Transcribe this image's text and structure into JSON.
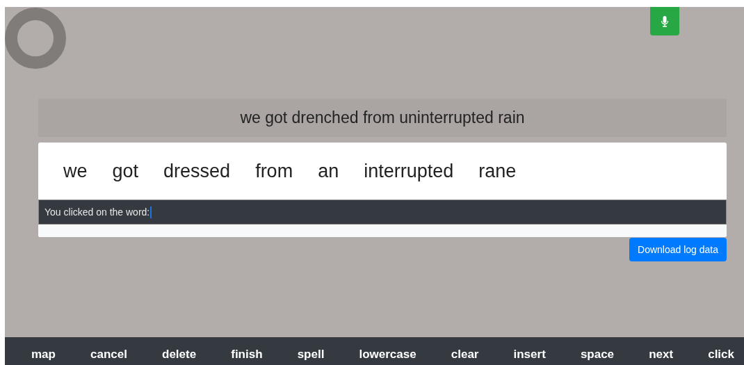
{
  "target_sentence": "we got drenched from uninterrupted rain",
  "recognized_words": [
    {
      "text": "we",
      "selected": false
    },
    {
      "text": "got",
      "selected": false
    },
    {
      "text": "dressed",
      "selected": false
    },
    {
      "text": "from",
      "selected": false
    },
    {
      "text": "an",
      "selected": false
    },
    {
      "text": "interrupted",
      "selected": false
    },
    {
      "text": "rane",
      "selected": false
    }
  ],
  "status": {
    "text": "You clicked on the word:",
    "cursor": true
  },
  "download_button": "Download log data",
  "commands": [
    "map",
    "cancel",
    "delete",
    "finish",
    "spell",
    "lowercase",
    "clear",
    "insert",
    "space",
    "next",
    "click"
  ]
}
